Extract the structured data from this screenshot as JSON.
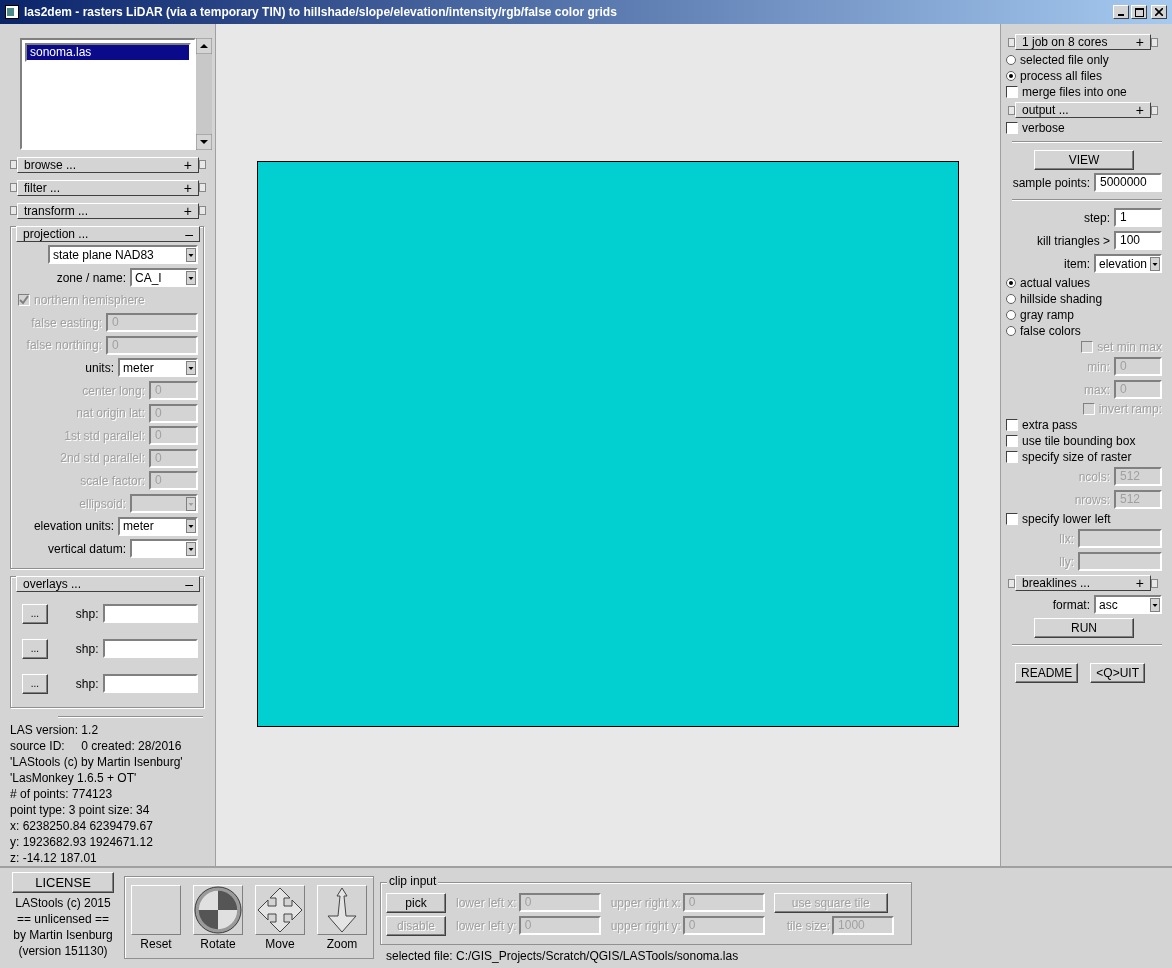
{
  "window": {
    "title": "las2dem - rasters LiDAR (via a temporary TIN) to hillshade/slope/elevation/intensity/rgb/false color grids"
  },
  "files": [
    {
      "label": "sonoma.las",
      "selected": true
    }
  ],
  "left": {
    "sections": [
      {
        "label": "browse ...",
        "sign": "+"
      },
      {
        "label": "filter ...",
        "sign": "+"
      },
      {
        "label": "transform ...",
        "sign": "+"
      }
    ],
    "projection": {
      "label": "projection ...",
      "sign": "–",
      "rows": [
        {
          "kind": "select",
          "value": "state plane NAD83",
          "disabled": false
        },
        {
          "kind": "select",
          "label": "zone / name:",
          "value": "CA_I",
          "disabled": false
        },
        {
          "kind": "checkbox",
          "label": "northern hemisphere",
          "checked": true,
          "disabled": true
        },
        {
          "kind": "field",
          "label": "false easting:",
          "value": "0",
          "disabled": true
        },
        {
          "kind": "field",
          "label": "false northing:",
          "value": "0",
          "disabled": true
        },
        {
          "kind": "select",
          "label": "units:",
          "value": "meter",
          "disabled": false
        },
        {
          "kind": "field",
          "label": "center long:",
          "value": "0",
          "disabled": true
        },
        {
          "kind": "field",
          "label": "nat origin lat:",
          "value": "0",
          "disabled": true
        },
        {
          "kind": "field",
          "label": "1st std parallel:",
          "value": "0",
          "disabled": true
        },
        {
          "kind": "field",
          "label": "2nd std parallel:",
          "value": "0",
          "disabled": true
        },
        {
          "kind": "field",
          "label": "scale factor:",
          "value": "0",
          "disabled": true
        },
        {
          "kind": "select",
          "label": "ellipsoid:",
          "disabled": true
        },
        {
          "kind": "select",
          "label": "elevation units:",
          "value": "meter",
          "disabled": false
        },
        {
          "kind": "select",
          "label": "vertical datum:",
          "disabled": false
        }
      ]
    },
    "overlays": {
      "label": "overlays ...",
      "sign": "–",
      "rows": [
        {
          "button": "...",
          "label": "shp:"
        },
        {
          "button": "...",
          "label": "shp:"
        },
        {
          "button": "...",
          "label": "shp:"
        }
      ]
    },
    "info": [
      "LAS version: 1.2",
      "source ID:     0 created: 28/2016",
      "'LAStools (c) by Martin Isenburg'",
      "'LasMonkey 1.6.5 + OT'",
      "# of points: 774123",
      "point type: 3 point size: 34",
      "x: 6238250.84 6239479.67",
      "y: 1923682.93 1924671.12",
      "z: -14.12 187.01"
    ]
  },
  "right": {
    "rows": [
      {
        "kind": "section",
        "label": "1 job on 8 cores",
        "sign": "+"
      },
      {
        "kind": "radio",
        "label": "selected file only",
        "selected": false
      },
      {
        "kind": "radio",
        "label": "process all files",
        "selected": true
      },
      {
        "kind": "checkbox",
        "label": "merge files into one",
        "checked": false,
        "disabled": false
      },
      {
        "kind": "section",
        "label": "output ...",
        "sign": "+"
      },
      {
        "kind": "checkbox",
        "label": "verbose",
        "checked": false,
        "disabled": false
      },
      {
        "kind": "divider"
      },
      {
        "kind": "button",
        "label": "VIEW"
      },
      {
        "kind": "field",
        "label": "sample points:",
        "value": "5000000",
        "disabled": false
      },
      {
        "kind": "divider"
      },
      {
        "kind": "field",
        "label": "step:",
        "value": "1",
        "disabled": false
      },
      {
        "kind": "field",
        "label": "kill triangles >",
        "value": "100",
        "disabled": false
      },
      {
        "kind": "select",
        "label": "item:",
        "value": "elevation",
        "disabled": false
      },
      {
        "kind": "radio",
        "label": "actual values",
        "selected": true
      },
      {
        "kind": "radio",
        "label": "hillside shading",
        "selected": false
      },
      {
        "kind": "radio",
        "label": "gray ramp",
        "selected": false
      },
      {
        "kind": "radio",
        "label": "false colors",
        "selected": false
      },
      {
        "kind": "checkbox",
        "label": "set min max",
        "checked": false,
        "disabled": true
      },
      {
        "kind": "field",
        "label": "min:",
        "value": "0",
        "disabled": true
      },
      {
        "kind": "field",
        "label": "max:",
        "value": "0",
        "disabled": true
      },
      {
        "kind": "checkbox",
        "label": "invert ramp:",
        "checked": false,
        "disabled": true
      },
      {
        "kind": "checkbox",
        "label": "extra pass",
        "checked": false,
        "disabled": false
      },
      {
        "kind": "checkbox",
        "label": "use tile bounding box",
        "checked": false,
        "disabled": false
      },
      {
        "kind": "checkbox",
        "label": "specify size of raster",
        "checked": false,
        "disabled": false
      },
      {
        "kind": "field",
        "label": "ncols:",
        "value": "512",
        "disabled": true
      },
      {
        "kind": "field",
        "label": "nrows:",
        "value": "512",
        "disabled": true
      },
      {
        "kind": "checkbox",
        "label": "specify lower left",
        "checked": false,
        "disabled": false
      },
      {
        "kind": "field",
        "label": "llx:",
        "disabled": true
      },
      {
        "kind": "field",
        "label": "lly:",
        "disabled": true
      },
      {
        "kind": "section",
        "label": "breaklines ...",
        "sign": "+"
      },
      {
        "kind": "select",
        "label": "format:",
        "value": "asc",
        "disabled": false
      },
      {
        "kind": "button",
        "label": "RUN"
      },
      {
        "kind": "divider"
      },
      {
        "kind": "buttons",
        "labels": [
          "README",
          "<Q>UIT"
        ]
      }
    ]
  },
  "bottom": {
    "license": {
      "button": "LICENSE",
      "lines": [
        "LAStools (c) 2015",
        "== unlicensed ==",
        "by Martin Isenburg",
        "(version 151130)"
      ]
    },
    "tools": [
      {
        "kind": "reset",
        "label": "Reset"
      },
      {
        "kind": "rotate",
        "label": "Rotate"
      },
      {
        "kind": "move",
        "label": "Move"
      },
      {
        "kind": "zoom",
        "label": "Zoom"
      }
    ],
    "clip": {
      "title": "clip input",
      "rows": [
        {
          "button": "pick",
          "button_disabled": false,
          "fields": [
            {
              "label": "lower left x:",
              "value": "0",
              "disabled": true
            },
            {
              "label": "upper right x:",
              "value": "0",
              "disabled": true
            }
          ],
          "extra": {
            "kind": "button",
            "label": "use square tile",
            "disabled": true
          }
        },
        {
          "button": "disable",
          "button_disabled": true,
          "fields": [
            {
              "label": "lower left y:",
              "value": "0",
              "disabled": true
            },
            {
              "label": "upper right y:",
              "value": "0",
              "disabled": true
            }
          ],
          "extra": {
            "kind": "field",
            "label": "tile size:",
            "value": "1000",
            "disabled": true
          }
        }
      ],
      "selected_file": "selected file: C:/GIS_Projects/Scratch/QGIS/LASTools/sonoma.las"
    }
  }
}
